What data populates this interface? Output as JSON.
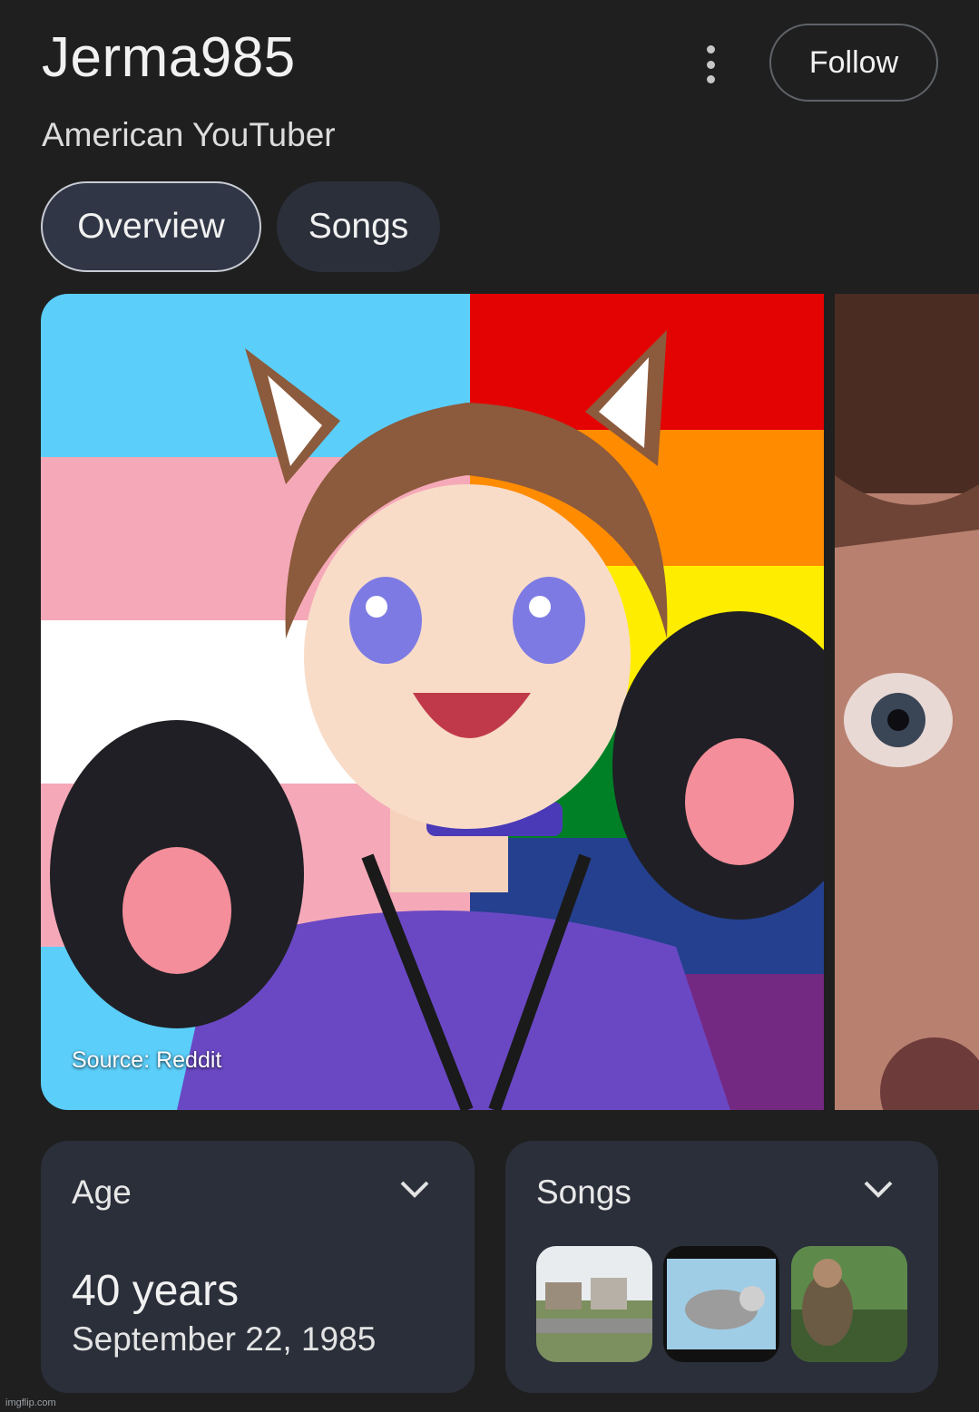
{
  "header": {
    "title": "Jerma985",
    "subtitle": "American YouTuber",
    "follow_label": "Follow",
    "more_icon": "more-vert-icon"
  },
  "tabs": [
    {
      "label": "Overview",
      "selected": true
    },
    {
      "label": "Songs",
      "selected": false
    }
  ],
  "gallery": {
    "source_label": "Source: Reddit"
  },
  "age_card": {
    "title": "Age",
    "value": "40 years",
    "birth_date": "September 22, 1985"
  },
  "songs_card": {
    "title": "Songs",
    "thumbnail_count": 3
  },
  "watermark": "imgflip.com",
  "colors": {
    "background": "#1f1f1f",
    "card": "#2a2f3a",
    "chip_selected": "#303645"
  }
}
